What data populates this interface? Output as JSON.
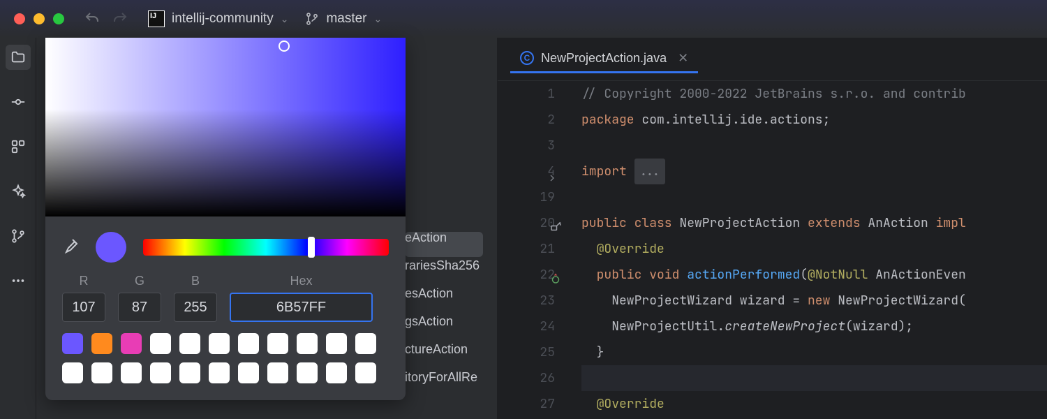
{
  "titlebar": {
    "project_name": "intellij-community",
    "branch_name": "master"
  },
  "sidebar_icons": [
    "folder",
    "commit",
    "structure",
    "ai",
    "git-branch",
    "more"
  ],
  "colorpicker": {
    "labels": {
      "r": "R",
      "g": "G",
      "b": "B",
      "hex": "Hex"
    },
    "r": "107",
    "g": "87",
    "b": "255",
    "hex": "6B57FF",
    "current_hex": "#6B57FF",
    "swatches_row1": [
      "#6b57ff",
      "#ff8a1e",
      "#e83db5",
      "#ffffff",
      "#ffffff",
      "#ffffff",
      "#ffffff",
      "#ffffff",
      "#ffffff",
      "#ffffff",
      "#ffffff"
    ],
    "swatches_row2": [
      "#ffffff",
      "#ffffff",
      "#ffffff",
      "#ffffff",
      "#ffffff",
      "#ffffff",
      "#ffffff",
      "#ffffff",
      "#ffffff",
      "#ffffff",
      "#ffffff"
    ]
  },
  "list_fragment": [
    "eAction",
    "rariesSha256",
    "esAction",
    "gsAction",
    "ctureAction",
    "itoryForAllRe"
  ],
  "tab": {
    "filename": "NewProjectAction.java"
  },
  "editor": {
    "line_numbers": [
      "1",
      "2",
      "3",
      "4",
      "19",
      "20",
      "21",
      "22",
      "23",
      "24",
      "25",
      "26",
      "27"
    ],
    "lines": [
      {
        "seg": [
          {
            "cls": "c-comment",
            "t": "// Copyright 2000-2022 JetBrains s.r.o. and contrib"
          }
        ]
      },
      {
        "seg": [
          {
            "cls": "c-kw",
            "t": "package "
          },
          {
            "cls": "",
            "t": "com.intellij.ide.actions;"
          }
        ]
      },
      {
        "seg": []
      },
      {
        "seg": [
          {
            "cls": "c-kw",
            "t": "import "
          },
          {
            "cls": "fold-box",
            "t": "..."
          }
        ],
        "fold_arrow": true
      },
      {
        "seg": []
      },
      {
        "seg": [
          {
            "cls": "c-kw",
            "t": "public class "
          },
          {
            "cls": "",
            "t": "NewProjectAction "
          },
          {
            "cls": "c-kw",
            "t": "extends "
          },
          {
            "cls": "",
            "t": "AnAction "
          },
          {
            "cls": "c-kw",
            "t": "impl"
          }
        ],
        "impl_icon": true
      },
      {
        "seg": [
          {
            "cls": "",
            "t": "  "
          },
          {
            "cls": "c-ann",
            "t": "@Override"
          }
        ]
      },
      {
        "seg": [
          {
            "cls": "",
            "t": "  "
          },
          {
            "cls": "c-kw",
            "t": "public void "
          },
          {
            "cls": "c-fn",
            "t": "actionPerformed"
          },
          {
            "cls": "",
            "t": "("
          },
          {
            "cls": "c-ann",
            "t": "@NotNull"
          },
          {
            "cls": "",
            "t": " AnActionEven"
          }
        ],
        "override_icon": true
      },
      {
        "seg": [
          {
            "cls": "",
            "t": "    NewProjectWizard wizard = "
          },
          {
            "cls": "c-kw",
            "t": "new "
          },
          {
            "cls": "",
            "t": "NewProjectWizard("
          }
        ]
      },
      {
        "seg": [
          {
            "cls": "",
            "t": "    NewProjectUtil."
          },
          {
            "cls": "c-it",
            "t": "createNewProject"
          },
          {
            "cls": "",
            "t": "(wizard);"
          }
        ]
      },
      {
        "seg": [
          {
            "cls": "",
            "t": "  }"
          }
        ]
      },
      {
        "seg": [],
        "hl": true
      },
      {
        "seg": [
          {
            "cls": "",
            "t": "  "
          },
          {
            "cls": "c-ann",
            "t": "@Override"
          }
        ]
      }
    ]
  }
}
